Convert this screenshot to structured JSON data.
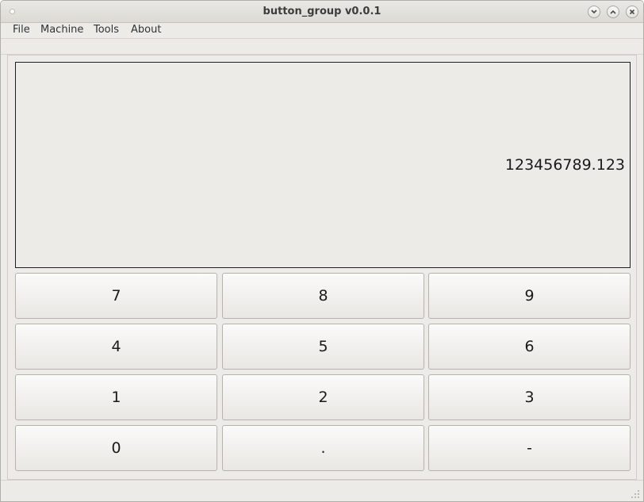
{
  "window": {
    "title": "button_group v0.0.1"
  },
  "menubar": {
    "items": [
      "File",
      "Machine",
      "Tools",
      "About"
    ]
  },
  "display": {
    "value": "123456789.123"
  },
  "keypad": {
    "rows": [
      [
        "7",
        "8",
        "9"
      ],
      [
        "4",
        "5",
        "6"
      ],
      [
        "1",
        "2",
        "3"
      ],
      [
        "0",
        ".",
        "-"
      ]
    ]
  }
}
